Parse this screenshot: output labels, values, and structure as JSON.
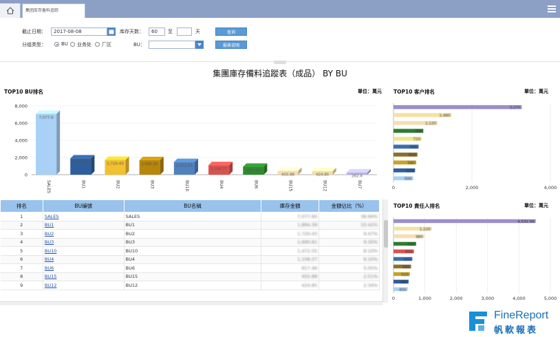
{
  "topbar": {
    "home_icon": "home-icon",
    "tab_label": "集团库存备料追踪",
    "menu_icon": "hamburger-menu-icon"
  },
  "form": {
    "date_label": "截止日期：",
    "date_value": "2017-08-08",
    "days_label": "库存天数：",
    "days_from": "60",
    "days_to_label": "至",
    "days_to": "",
    "days_unit": "天",
    "query_button": "查询",
    "group_label": "分组类型：",
    "radio_bu": "BU",
    "radio_office": "业务处",
    "radio_factory": "厂区",
    "bu_label": "BU：",
    "bu_value": "",
    "report_button": "报表说明"
  },
  "report_title": "集團庫存備料追蹤表（成品） BY BU",
  "bu_chart_title": "TOP10 BU排名",
  "bu_chart_unit": "單位：萬元",
  "customer_chart_title": "TOP10 客户排名",
  "customer_chart_unit": "單位：萬元",
  "person_chart_title": "TOP10 責任人排名",
  "person_chart_unit": "單位：萬元",
  "table": {
    "headers": [
      "排名",
      "BU编號",
      "BU名稱",
      "庫存金額",
      "金額佔比（%）"
    ],
    "rows": [
      {
        "rank": "1",
        "code": "SALES",
        "name": "SALES",
        "amount": "7,077.60",
        "pct": "38.94%"
      },
      {
        "rank": "2",
        "code": "BU1",
        "name": "BU1",
        "amount": "1,894.39",
        "pct": "10.42%"
      },
      {
        "rank": "3",
        "code": "BU2",
        "name": "BU2",
        "amount": "1,720.43",
        "pct": "9.47%"
      },
      {
        "rank": "4",
        "code": "BU3",
        "name": "BU3",
        "amount": "1,690.81",
        "pct": "9.30%"
      },
      {
        "rank": "5",
        "code": "BU10",
        "name": "BU10",
        "amount": "1,472.55",
        "pct": "8.10%"
      },
      {
        "rank": "6",
        "code": "BU4",
        "name": "BU4",
        "amount": "1,108.27",
        "pct": "6.10%"
      },
      {
        "rank": "7",
        "code": "BU6",
        "name": "BU6",
        "amount": "917.46",
        "pct": "5.05%"
      },
      {
        "rank": "8",
        "code": "BU15",
        "name": "BU15",
        "amount": "455.88",
        "pct": "2.51%"
      },
      {
        "rank": "9",
        "code": "BU12",
        "name": "BU12",
        "amount": "424.85",
        "pct": "2.34%"
      }
    ]
  },
  "logo": {
    "brand": "FineReport",
    "brand_cn": "帆軟報表",
    "icon": "finereport-logo-icon"
  },
  "chart_data": [
    {
      "type": "bar",
      "title": "TOP10 BU排名",
      "unit": "單位：萬元",
      "categories": [
        "SALES",
        "BU1",
        "BU2",
        "BU3",
        "BU10",
        "BU4",
        "BU6",
        "BU15",
        "BU12",
        "BU7"
      ],
      "values": [
        7077.6,
        1894.39,
        1720.43,
        1690.81,
        1472.55,
        1108.27,
        917.46,
        455.88,
        424.85,
        262.4
      ],
      "colors": [
        "#a9d0f5",
        "#2f5e9c",
        "#f2c12e",
        "#b8860b",
        "#4f81bd",
        "#d9534f",
        "#2e8b2e",
        "#f5deb3",
        "#f0e0a8",
        "#b7b3e0"
      ],
      "yticks": [
        0,
        2000,
        4000,
        6000,
        8000
      ],
      "ylim": [
        0,
        8000
      ]
    },
    {
      "type": "bar",
      "orientation": "horizontal",
      "title": "TOP10 客户排名",
      "unit": "單位：萬元",
      "values": [
        3270,
        1480,
        1120,
        760,
        720,
        640,
        610,
        580,
        550,
        500
      ],
      "colors": [
        "#9b8ec9",
        "#f5e1a4",
        "#f5deb3",
        "#2e7d32",
        "#f0e68c",
        "#3a6fb5",
        "#8b6f2e",
        "#c9a227",
        "#2f5e9c",
        "#a9d0f5"
      ],
      "xticks": [
        0,
        2000,
        4000
      ],
      "xlim": [
        0,
        4000
      ]
    },
    {
      "type": "bar",
      "orientation": "horizontal",
      "title": "TOP10 責任人排名",
      "unit": "單位：萬元",
      "values": [
        4532.99,
        1220,
        980,
        720,
        650,
        600,
        560,
        520,
        480,
        450
      ],
      "colors": [
        "#9b8ec9",
        "#f5e1a4",
        "#f5deb3",
        "#2e7d32",
        "#d9534f",
        "#3a6fb5",
        "#8b6f2e",
        "#c9a227",
        "#2f5e9c",
        "#a9d0f5"
      ],
      "top_label": "4,532.99",
      "xticks": [
        0,
        1000,
        2000,
        3000,
        4000,
        5000
      ],
      "xlim": [
        0,
        5000
      ]
    }
  ]
}
